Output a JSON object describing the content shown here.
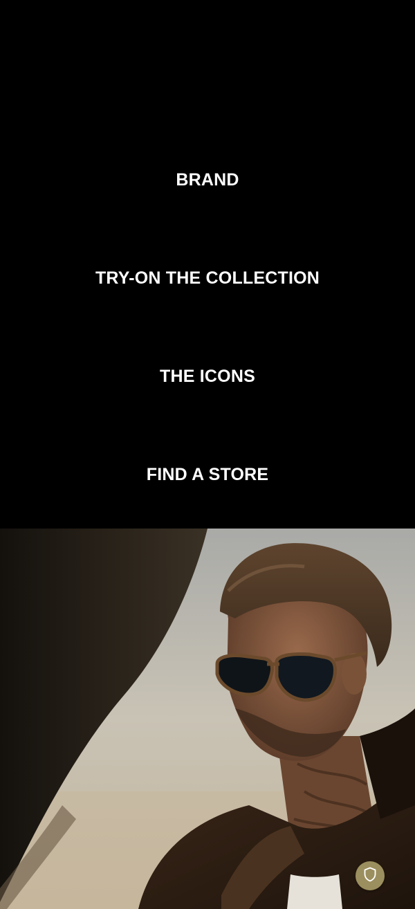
{
  "menu": {
    "items": [
      {
        "label": "BRAND"
      },
      {
        "label": "TRY-ON THE COLLECTION"
      },
      {
        "label": "THE ICONS"
      },
      {
        "label": "FIND A STORE"
      }
    ]
  },
  "hero": {
    "image": "man-in-sunglasses-photo"
  },
  "floating_button": {
    "icon": "shield-icon"
  },
  "colors": {
    "background": "#000000",
    "menu_text": "#ffffff",
    "floating_button": "#9c8f5f"
  }
}
